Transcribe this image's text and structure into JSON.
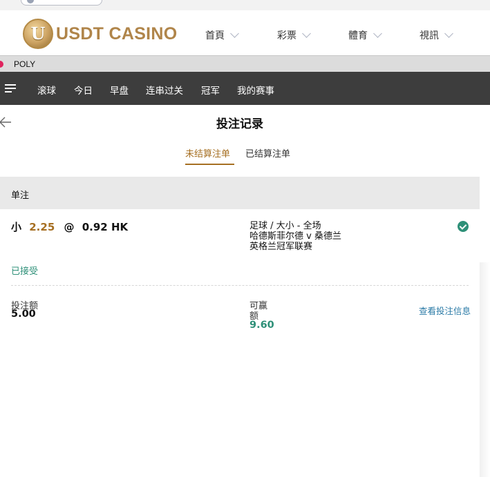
{
  "site": {
    "logo_text": "USDT CASINO",
    "nav": [
      {
        "label": "首頁"
      },
      {
        "label": "彩票"
      },
      {
        "label": "體育"
      },
      {
        "label": "視訊"
      }
    ]
  },
  "provider": {
    "label": "POLY"
  },
  "sports_nav": [
    "滚球",
    "今日",
    "早盘",
    "连串过关",
    "冠军",
    "我的赛事"
  ],
  "page": {
    "title": "投注记录",
    "tabs": [
      {
        "label": "未结算注单",
        "active": true
      },
      {
        "label": "已结算注单",
        "active": false
      }
    ]
  },
  "section": {
    "title": "单注"
  },
  "bet": {
    "selection": "小",
    "line": "2.25",
    "at": "@",
    "odds": "0.92 HK",
    "market": "足球 / 大小 - 全场",
    "match": "哈德斯菲尔德 v 桑德兰",
    "league": "英格兰冠军联赛",
    "status": "已接受",
    "stake_label": "投注额",
    "stake": "5.00",
    "win_label_1": "可赢",
    "win_label_2": "额",
    "win": "9.60",
    "detail_link": "查看投注信息"
  },
  "colors": {
    "brand_gold": "#b0854a",
    "accent": "#a66f22",
    "success": "#2e9078",
    "nav_bg": "#3d3d3d",
    "link": "#2a7aa6"
  },
  "icons": {
    "menu": "menu-icon",
    "back": "back-arrow-icon",
    "status": "check-circle-icon",
    "dropdown": "chevron-down-icon"
  }
}
